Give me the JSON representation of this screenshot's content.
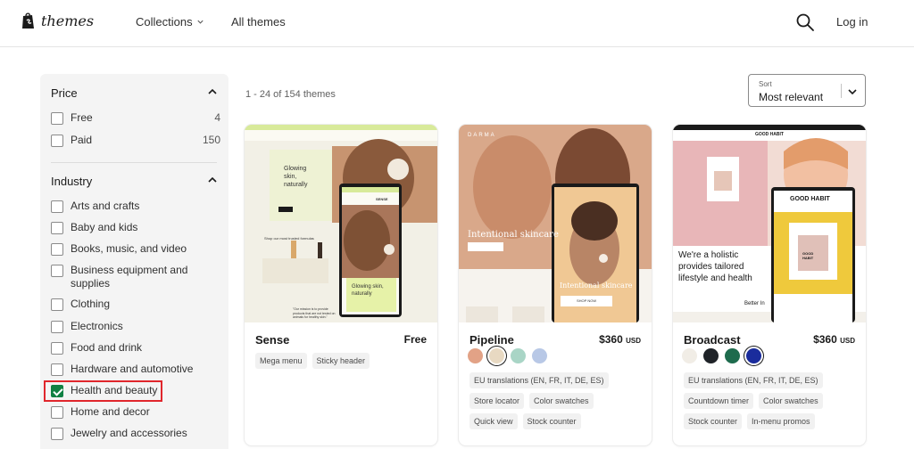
{
  "header": {
    "logo_text": "themes",
    "nav": [
      {
        "label": "Collections"
      },
      {
        "label": "All themes"
      }
    ],
    "login_label": "Log in"
  },
  "sidebar": {
    "price": {
      "heading": "Price",
      "options": [
        {
          "label": "Free",
          "count": "4",
          "checked": false
        },
        {
          "label": "Paid",
          "count": "150",
          "checked": false
        }
      ]
    },
    "industry": {
      "heading": "Industry",
      "options": [
        {
          "label": "Arts and crafts",
          "checked": false
        },
        {
          "label": "Baby and kids",
          "checked": false
        },
        {
          "label": "Books, music, and video",
          "checked": false
        },
        {
          "label": "Business equipment and supplies",
          "checked": false
        },
        {
          "label": "Clothing",
          "checked": false
        },
        {
          "label": "Electronics",
          "checked": false
        },
        {
          "label": "Food and drink",
          "checked": false
        },
        {
          "label": "Hardware and automotive",
          "checked": false
        },
        {
          "label": "Health and beauty",
          "checked": true
        },
        {
          "label": "Home and decor",
          "checked": false
        },
        {
          "label": "Jewelry and accessories",
          "checked": false
        }
      ]
    }
  },
  "results": {
    "count_text": "1 - 24 of 154 themes",
    "sort": {
      "label": "Sort",
      "value": "Most relevant"
    }
  },
  "themes": [
    {
      "name": "Sense",
      "price": "Free",
      "currency": "",
      "swatches": [],
      "tags": [
        [
          "Mega menu",
          "Sticky header"
        ]
      ],
      "preview": {
        "hero_text": "Glowing skin, naturally",
        "mobile_brand": "SENSE",
        "mobile_text": "Glowing skin, naturally",
        "section_text": "Shop our most trusted formulas",
        "mission_text": "\"Our mission is to provide products that are not tested on animals for healthy skin.\""
      }
    },
    {
      "name": "Pipeline",
      "price": "$360",
      "currency": "USD",
      "swatches": [
        "#e2a286",
        "#e8d9c2",
        "#a9d5c6",
        "#b8c8e6"
      ],
      "selected_swatch": 1,
      "tags": [
        [
          "EU translations (EN, FR, IT, DE, ES)"
        ],
        [
          "Store locator",
          "Color swatches"
        ],
        [
          "Quick view",
          "Stock counter"
        ]
      ],
      "preview": {
        "brand": "DARMA",
        "hero_text": "Intentional skincare",
        "mobile_text": "Intentional skincare",
        "cta": "SHOP NOW"
      }
    },
    {
      "name": "Broadcast",
      "price": "$360",
      "currency": "USD",
      "swatches": [
        "#f1ede6",
        "#1f2328",
        "#1e6b4d",
        "#1a2c9c"
      ],
      "selected_swatch": 3,
      "tags": [
        [
          "EU translations (EN, FR, IT, DE, ES)"
        ],
        [
          "Countdown timer",
          "Color swatches"
        ],
        [
          "Stock counter",
          "In-menu promos"
        ]
      ],
      "preview": {
        "brand": "GOOD HABIT",
        "hero_text_1": "We're a holistic",
        "hero_text_2": "provides",
        "hero_text_3": "tailored",
        "hero_text_4": "lifestyle and health",
        "better": "Better In",
        "jar_text": "GOOD HABIT"
      }
    }
  ],
  "colors": {
    "accent_green": "#108043",
    "highlight_red": "#e0262c",
    "sidebar_bg": "#f4f4f4"
  }
}
